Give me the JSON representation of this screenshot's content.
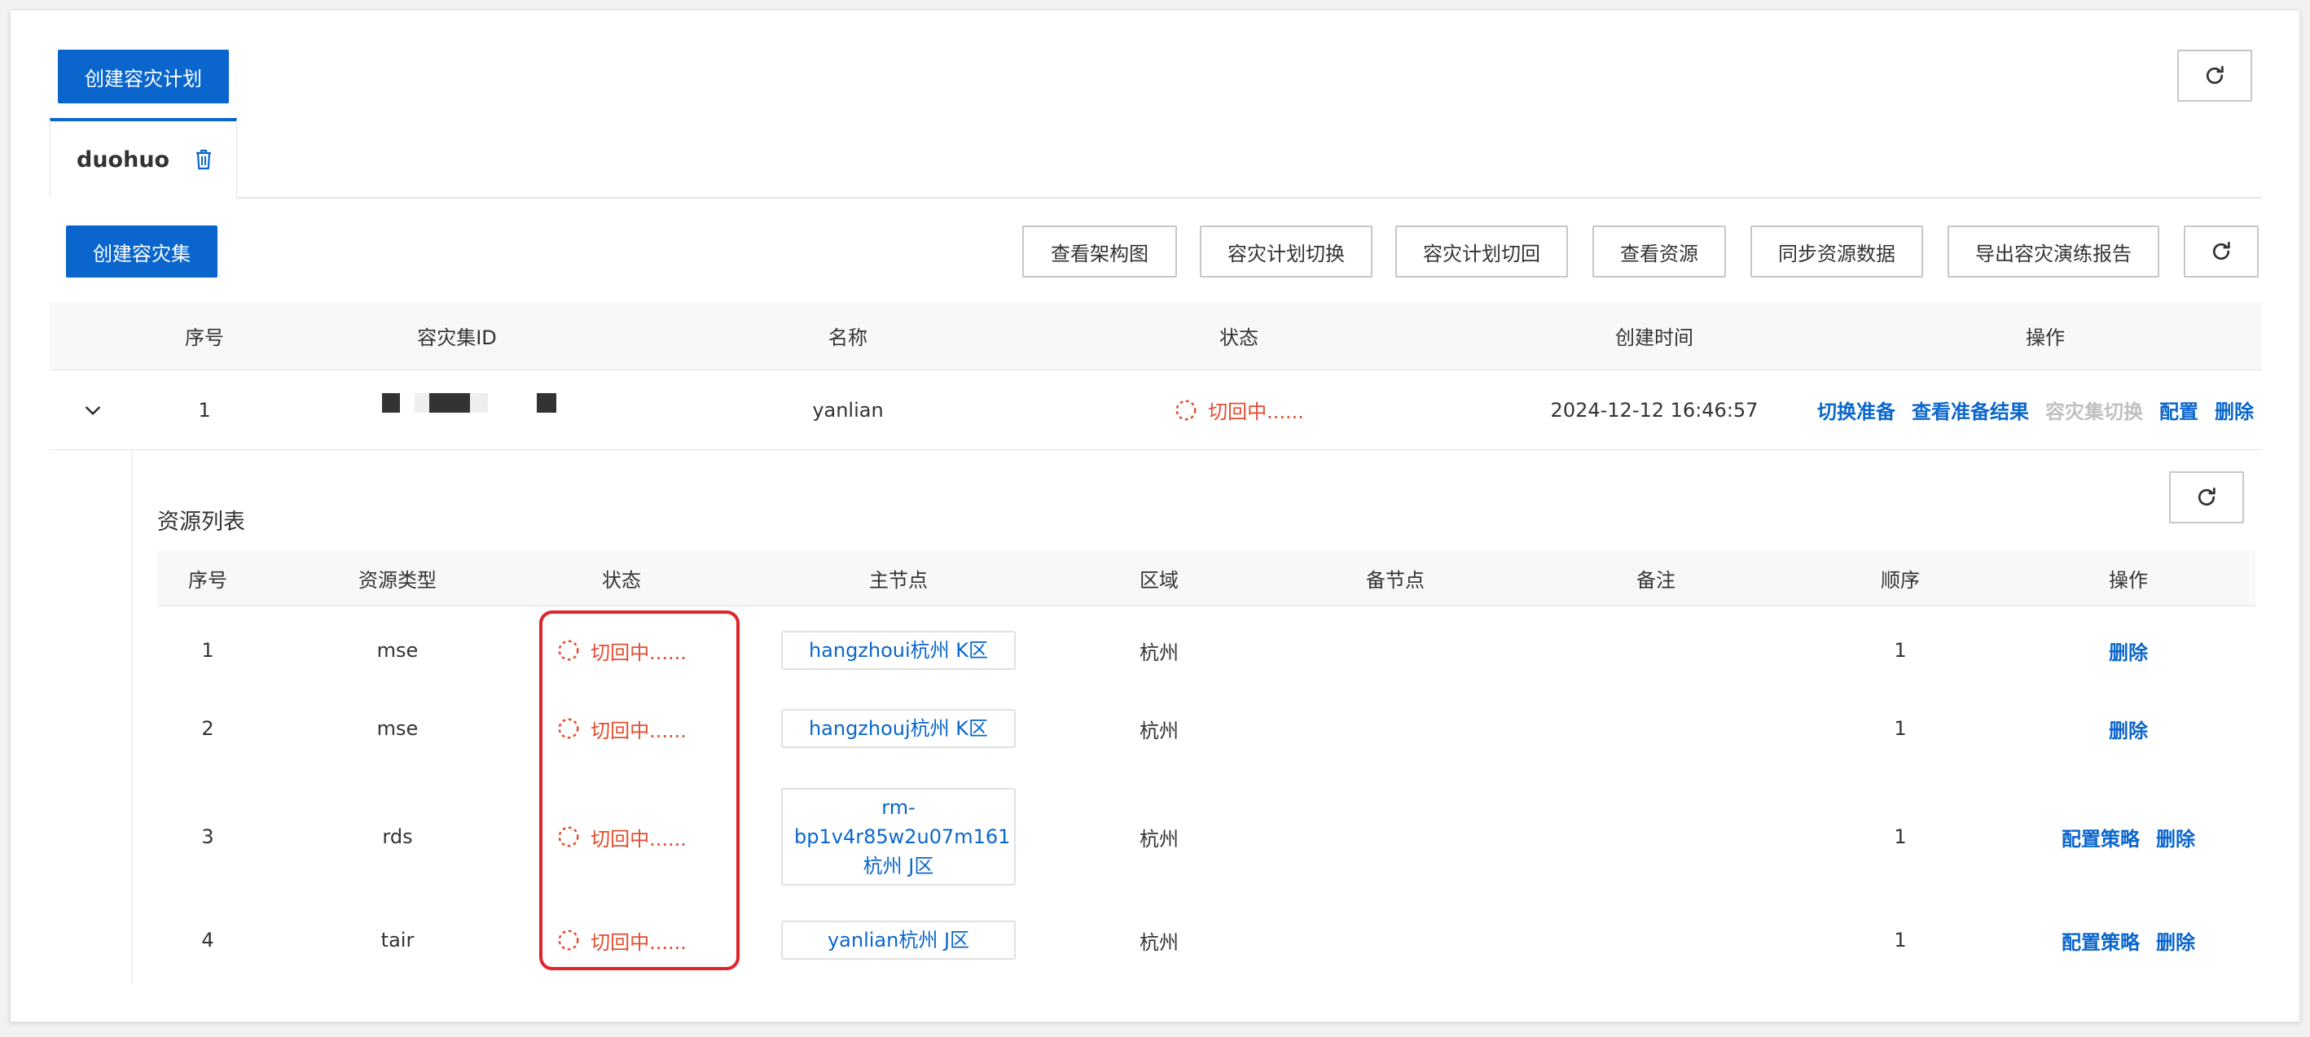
{
  "top": {
    "create_plan_label": "创建容灾计划"
  },
  "tab": {
    "label": "duohuo"
  },
  "toolbar": {
    "create_set_label": "创建容灾集",
    "buttons": [
      "查看架构图",
      "容灾计划切换",
      "容灾计划切回",
      "查看资源",
      "同步资源数据",
      "导出容灾演练报告"
    ]
  },
  "main_table": {
    "columns": [
      "序号",
      "容灾集ID",
      "名称",
      "状态",
      "创建时间",
      "操作"
    ],
    "row": {
      "index": "1",
      "name": "yanlian",
      "status": "切回中......",
      "created": "2024-12-12 16:46:57",
      "actions": [
        "切换准备",
        "查看准备结果",
        "容灾集切换",
        "配置",
        "删除"
      ]
    }
  },
  "resources": {
    "title": "资源列表",
    "columns": [
      "序号",
      "资源类型",
      "状态",
      "主节点",
      "区域",
      "备节点",
      "备注",
      "顺序",
      "操作"
    ],
    "rows": [
      {
        "index": "1",
        "type": "mse",
        "status": "切回中......",
        "node": "hangzhoui杭州 K区",
        "region": "杭州",
        "order": "1",
        "actions": [
          "删除"
        ]
      },
      {
        "index": "2",
        "type": "mse",
        "status": "切回中......",
        "node": "hangzhouj杭州 K区",
        "region": "杭州",
        "order": "1",
        "actions": [
          "删除"
        ]
      },
      {
        "index": "3",
        "type": "rds",
        "status": "切回中......",
        "node": "rm-bp1v4r85w2u07m161杭州 J区",
        "node_lines": [
          "rm-",
          "bp1v4r85w2u07m161",
          "杭州 J区"
        ],
        "region": "杭州",
        "order": "1",
        "actions": [
          "配置策略",
          "删除"
        ]
      },
      {
        "index": "4",
        "type": "tair",
        "status": "切回中......",
        "node": "yanlian杭州 J区",
        "region": "杭州",
        "order": "1",
        "actions": [
          "配置策略",
          "删除"
        ]
      }
    ]
  },
  "colors": {
    "primary": "#0a66cc",
    "status": "#e34d2f",
    "highlight": "#e0242c"
  },
  "icons": {
    "refresh": "refresh-icon",
    "delete": "trash-icon",
    "expand": "chevron-down-icon",
    "loading": "spinner-icon"
  }
}
